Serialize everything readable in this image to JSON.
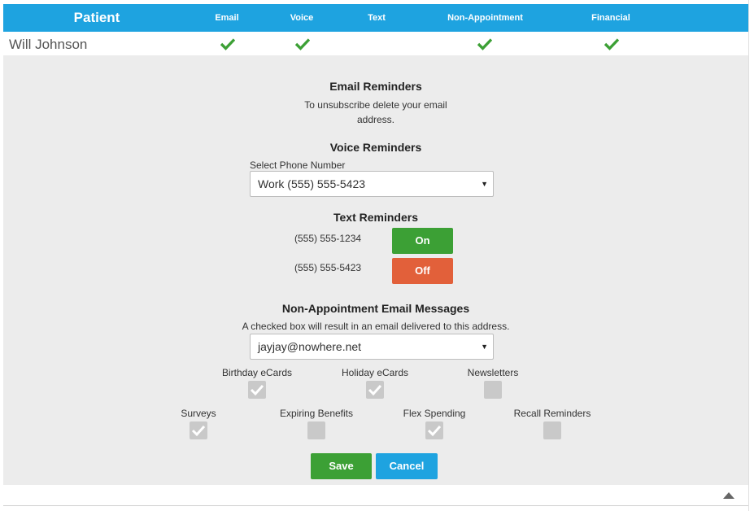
{
  "table": {
    "headers": {
      "patient": "Patient",
      "email": "Email",
      "voice": "Voice",
      "text": "Text",
      "non_appointment": "Non-Appointment",
      "financial": "Financial"
    },
    "patient_name": "Will Johnson",
    "checks": {
      "email": true,
      "voice": true,
      "text": false,
      "non_appointment": true,
      "financial": true
    }
  },
  "email_reminders": {
    "title": "Email Reminders",
    "note_line1": "To unsubscribe delete your email",
    "note_line2": "address."
  },
  "voice_reminders": {
    "title": "Voice Reminders",
    "select_label": "Select Phone Number",
    "selected_phone": "Work (555) 555-5423"
  },
  "text_reminders": {
    "title": "Text Reminders",
    "phones": [
      {
        "number": "(555) 555-1234",
        "state": "On"
      },
      {
        "number": "(555) 555-5423",
        "state": "Off"
      }
    ]
  },
  "non_appointment": {
    "title": "Non-Appointment Email Messages",
    "note": "A checked box will result in an email delivered to this address.",
    "selected_email": "jayjay@nowhere.net",
    "options": [
      {
        "label": "Birthday eCards",
        "checked": true
      },
      {
        "label": "Holiday eCards",
        "checked": true
      },
      {
        "label": "Newsletters",
        "checked": false
      },
      {
        "label": "Surveys",
        "checked": true
      },
      {
        "label": "Expiring Benefits",
        "checked": false
      },
      {
        "label": "Flex Spending",
        "checked": true
      },
      {
        "label": "Recall Reminders",
        "checked": false
      }
    ]
  },
  "actions": {
    "save": "Save",
    "cancel": "Cancel"
  },
  "colors": {
    "header": "#1ea3e0",
    "green": "#3ca035",
    "orange": "#e2603a",
    "check": "#3ca035"
  }
}
